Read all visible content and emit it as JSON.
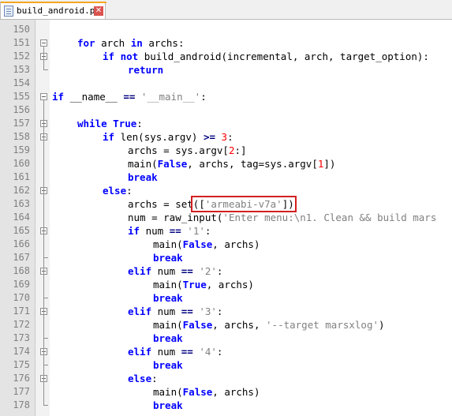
{
  "tab": {
    "filename": "build_android.py",
    "accent_color": "#f5a623",
    "close_icon": "close-icon"
  },
  "colors": {
    "keyword": "#0000ff",
    "string": "#808080",
    "number": "#ff0000",
    "highlight_box": "#d21f1f"
  },
  "lines": [
    {
      "n": "150",
      "indent": 0,
      "fold": "",
      "tokens": []
    },
    {
      "n": "151",
      "indent": 1,
      "fold": "open",
      "tokens": [
        [
          "kw",
          "for"
        ],
        [
          "t",
          " arch "
        ],
        [
          "kw",
          "in"
        ],
        [
          "t",
          " archs:"
        ]
      ]
    },
    {
      "n": "152",
      "indent": 2,
      "fold": "open",
      "tokens": [
        [
          "kw",
          "if"
        ],
        [
          "t",
          " "
        ],
        [
          "kw",
          "not"
        ],
        [
          "t",
          " build_android(incremental, arch, target_option):"
        ]
      ]
    },
    {
      "n": "153",
      "indent": 3,
      "fold": "end",
      "tokens": [
        [
          "kw",
          "return"
        ]
      ]
    },
    {
      "n": "154",
      "indent": 0,
      "fold": "",
      "tokens": []
    },
    {
      "n": "155",
      "indent": 0,
      "fold": "open",
      "tokens": [
        [
          "kw",
          "if"
        ],
        [
          "t",
          " __name__ "
        ],
        [
          "op",
          "=="
        ],
        [
          "t",
          " "
        ],
        [
          "str",
          "'__main__'"
        ],
        [
          "t",
          ":"
        ]
      ]
    },
    {
      "n": "156",
      "indent": 0,
      "fold": "",
      "tokens": []
    },
    {
      "n": "157",
      "indent": 1,
      "fold": "open",
      "tokens": [
        [
          "kw",
          "while"
        ],
        [
          "t",
          " "
        ],
        [
          "kw",
          "True"
        ],
        [
          "t",
          ":"
        ]
      ]
    },
    {
      "n": "158",
      "indent": 2,
      "fold": "open",
      "tokens": [
        [
          "kw",
          "if"
        ],
        [
          "t",
          " len(sys.argv) "
        ],
        [
          "op",
          ">="
        ],
        [
          "t",
          " "
        ],
        [
          "num",
          "3"
        ],
        [
          "t",
          ":"
        ]
      ]
    },
    {
      "n": "159",
      "indent": 3,
      "fold": "",
      "tokens": [
        [
          "t",
          "archs = sys.argv["
        ],
        [
          "num",
          "2"
        ],
        [
          "t",
          ":]"
        ]
      ]
    },
    {
      "n": "160",
      "indent": 3,
      "fold": "",
      "tokens": [
        [
          "t",
          "main("
        ],
        [
          "kw",
          "False"
        ],
        [
          "t",
          ", archs, tag=sys.argv["
        ],
        [
          "num",
          "1"
        ],
        [
          "t",
          "])"
        ]
      ]
    },
    {
      "n": "161",
      "indent": 3,
      "fold": "",
      "tokens": [
        [
          "kw",
          "break"
        ]
      ]
    },
    {
      "n": "162",
      "indent": 2,
      "fold": "open",
      "tokens": [
        [
          "kw",
          "else"
        ],
        [
          "t",
          ":"
        ]
      ]
    },
    {
      "n": "163",
      "indent": 3,
      "fold": "",
      "tokens": [
        [
          "t",
          "archs = set"
        ],
        [
          "hl",
          "(["
        ],
        [
          "hlstr",
          "'armeabi-v7a'"
        ],
        [
          "hl",
          "])"
        ]
      ]
    },
    {
      "n": "164",
      "indent": 3,
      "fold": "",
      "tokens": [
        [
          "t",
          "num = raw_input("
        ],
        [
          "str",
          "'Enter menu:\\n1. Clean && build mars"
        ]
      ]
    },
    {
      "n": "165",
      "indent": 3,
      "fold": "open",
      "tokens": [
        [
          "kw",
          "if"
        ],
        [
          "t",
          " num "
        ],
        [
          "op",
          "=="
        ],
        [
          "t",
          " "
        ],
        [
          "str",
          "'1'"
        ],
        [
          "t",
          ":"
        ]
      ]
    },
    {
      "n": "166",
      "indent": 4,
      "fold": "",
      "tokens": [
        [
          "t",
          "main("
        ],
        [
          "kw",
          "False"
        ],
        [
          "t",
          ", archs)"
        ]
      ]
    },
    {
      "n": "167",
      "indent": 4,
      "fold": "end",
      "tokens": [
        [
          "kw",
          "break"
        ]
      ]
    },
    {
      "n": "168",
      "indent": 3,
      "fold": "open",
      "tokens": [
        [
          "kw",
          "elif"
        ],
        [
          "t",
          " num "
        ],
        [
          "op",
          "=="
        ],
        [
          "t",
          " "
        ],
        [
          "str",
          "'2'"
        ],
        [
          "t",
          ":"
        ]
      ]
    },
    {
      "n": "169",
      "indent": 4,
      "fold": "",
      "tokens": [
        [
          "t",
          "main("
        ],
        [
          "kw",
          "True"
        ],
        [
          "t",
          ", archs)"
        ]
      ]
    },
    {
      "n": "170",
      "indent": 4,
      "fold": "end",
      "tokens": [
        [
          "kw",
          "break"
        ]
      ]
    },
    {
      "n": "171",
      "indent": 3,
      "fold": "open",
      "tokens": [
        [
          "kw",
          "elif"
        ],
        [
          "t",
          " num "
        ],
        [
          "op",
          "=="
        ],
        [
          "t",
          " "
        ],
        [
          "str",
          "'3'"
        ],
        [
          "t",
          ":"
        ]
      ]
    },
    {
      "n": "172",
      "indent": 4,
      "fold": "",
      "tokens": [
        [
          "t",
          "main("
        ],
        [
          "kw",
          "False"
        ],
        [
          "t",
          ", archs, "
        ],
        [
          "str",
          "'--target marsxlog'"
        ],
        [
          "t",
          ")"
        ]
      ]
    },
    {
      "n": "173",
      "indent": 4,
      "fold": "end",
      "tokens": [
        [
          "kw",
          "break"
        ]
      ]
    },
    {
      "n": "174",
      "indent": 3,
      "fold": "open",
      "tokens": [
        [
          "kw",
          "elif"
        ],
        [
          "t",
          " num "
        ],
        [
          "op",
          "=="
        ],
        [
          "t",
          " "
        ],
        [
          "str",
          "'4'"
        ],
        [
          "t",
          ":"
        ]
      ]
    },
    {
      "n": "175",
      "indent": 4,
      "fold": "end",
      "tokens": [
        [
          "kw",
          "break"
        ]
      ]
    },
    {
      "n": "176",
      "indent": 3,
      "fold": "open",
      "tokens": [
        [
          "kw",
          "else"
        ],
        [
          "t",
          ":"
        ]
      ]
    },
    {
      "n": "177",
      "indent": 4,
      "fold": "",
      "tokens": [
        [
          "t",
          "main("
        ],
        [
          "kw",
          "False"
        ],
        [
          "t",
          ", archs)"
        ]
      ]
    },
    {
      "n": "178",
      "indent": 4,
      "fold": "end",
      "tokens": [
        [
          "kw",
          "break"
        ]
      ]
    }
  ]
}
